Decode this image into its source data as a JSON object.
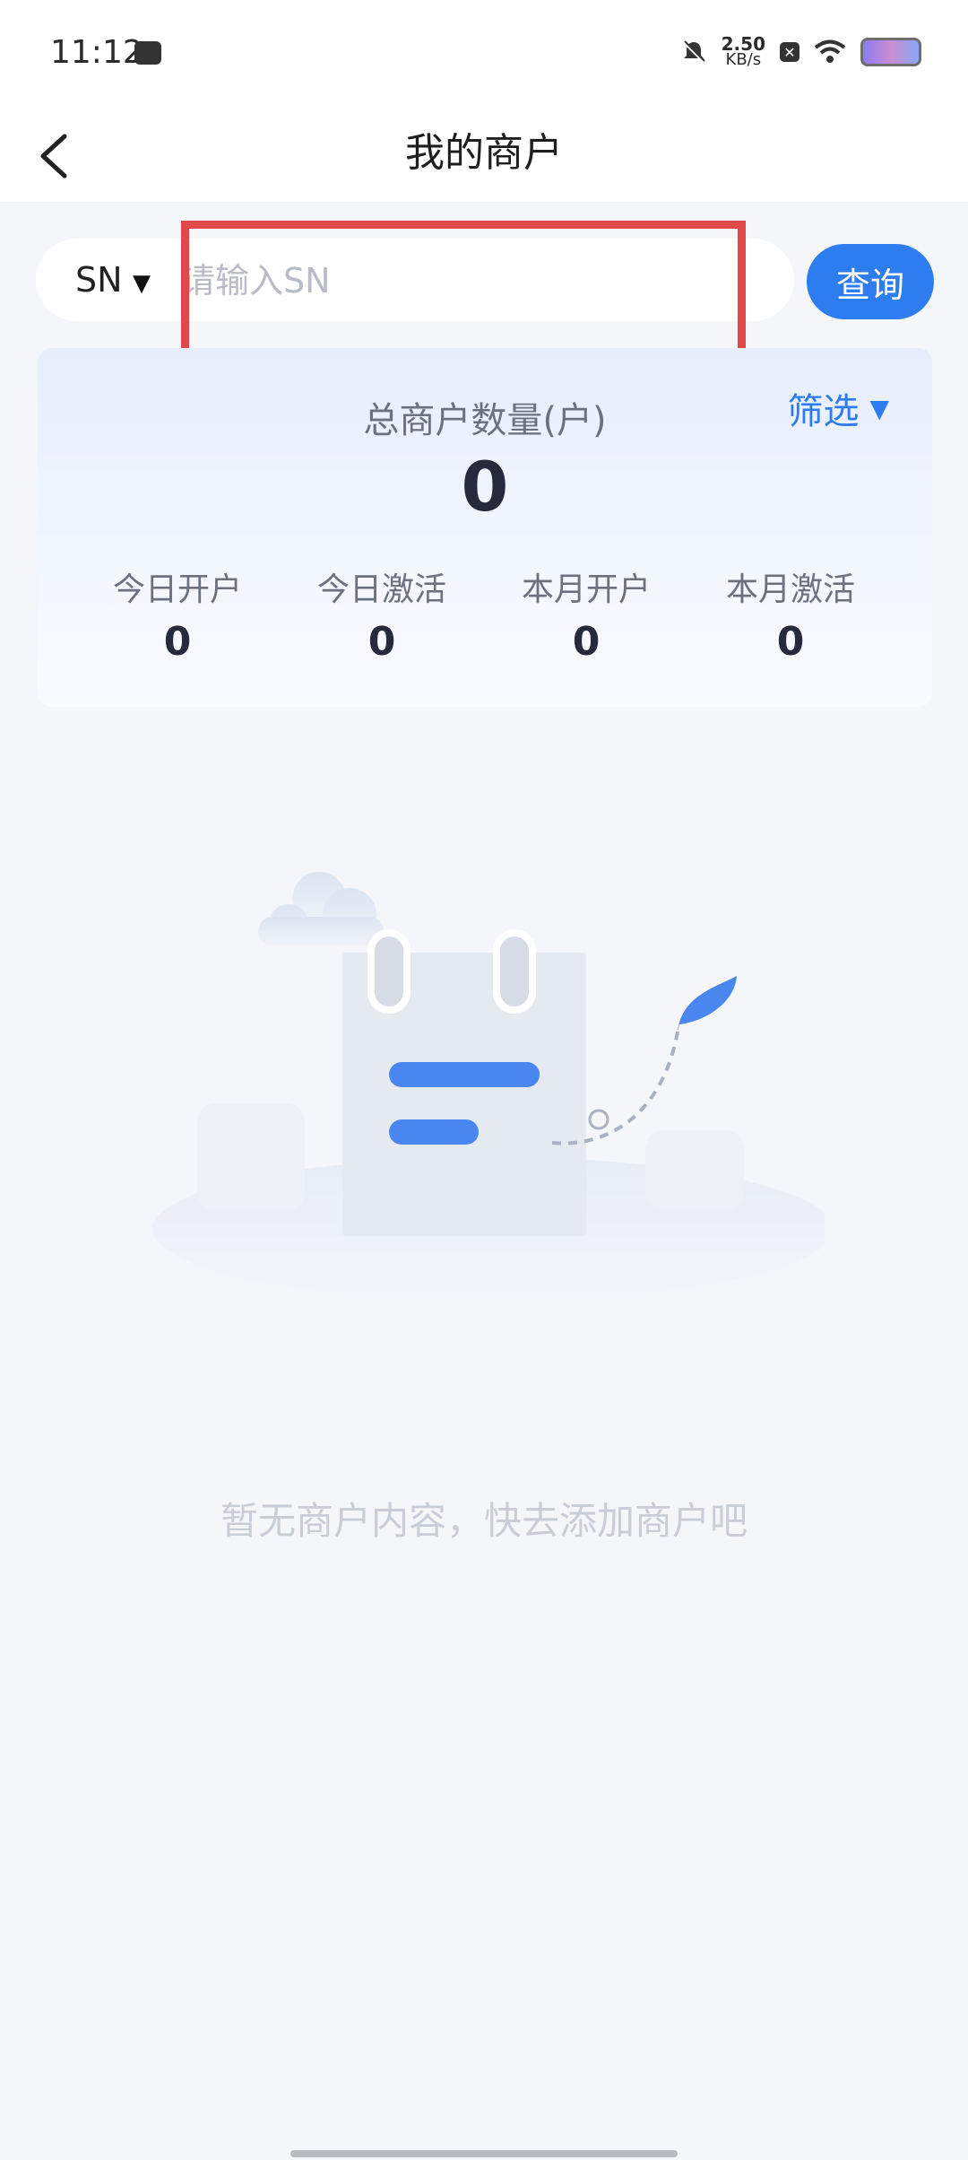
{
  "status_bar": {
    "time": "11:12",
    "net_speed_value": "2.50",
    "net_speed_unit": "KB/s"
  },
  "nav": {
    "title": "我的商户"
  },
  "search": {
    "type_label": "SN",
    "placeholder": "请输入SN",
    "value": "",
    "query_button": "查询"
  },
  "stats": {
    "total_label": "总商户数量(户)",
    "total_value": "0",
    "filter_label": "筛选",
    "items": [
      {
        "label": "今日开户",
        "value": "0"
      },
      {
        "label": "今日激活",
        "value": "0"
      },
      {
        "label": "本月开户",
        "value": "0"
      },
      {
        "label": "本月激活",
        "value": "0"
      }
    ]
  },
  "empty_state": {
    "message": "暂无商户内容，快去添加商户吧"
  },
  "colors": {
    "accent": "#2E7DF0",
    "highlight_box": "#E0484A",
    "background": "#F4F6FA"
  },
  "icons": [
    "back-chevron-icon",
    "dropdown-caret-icon",
    "filter-caret-icon",
    "empty-notebook-illustration"
  ]
}
